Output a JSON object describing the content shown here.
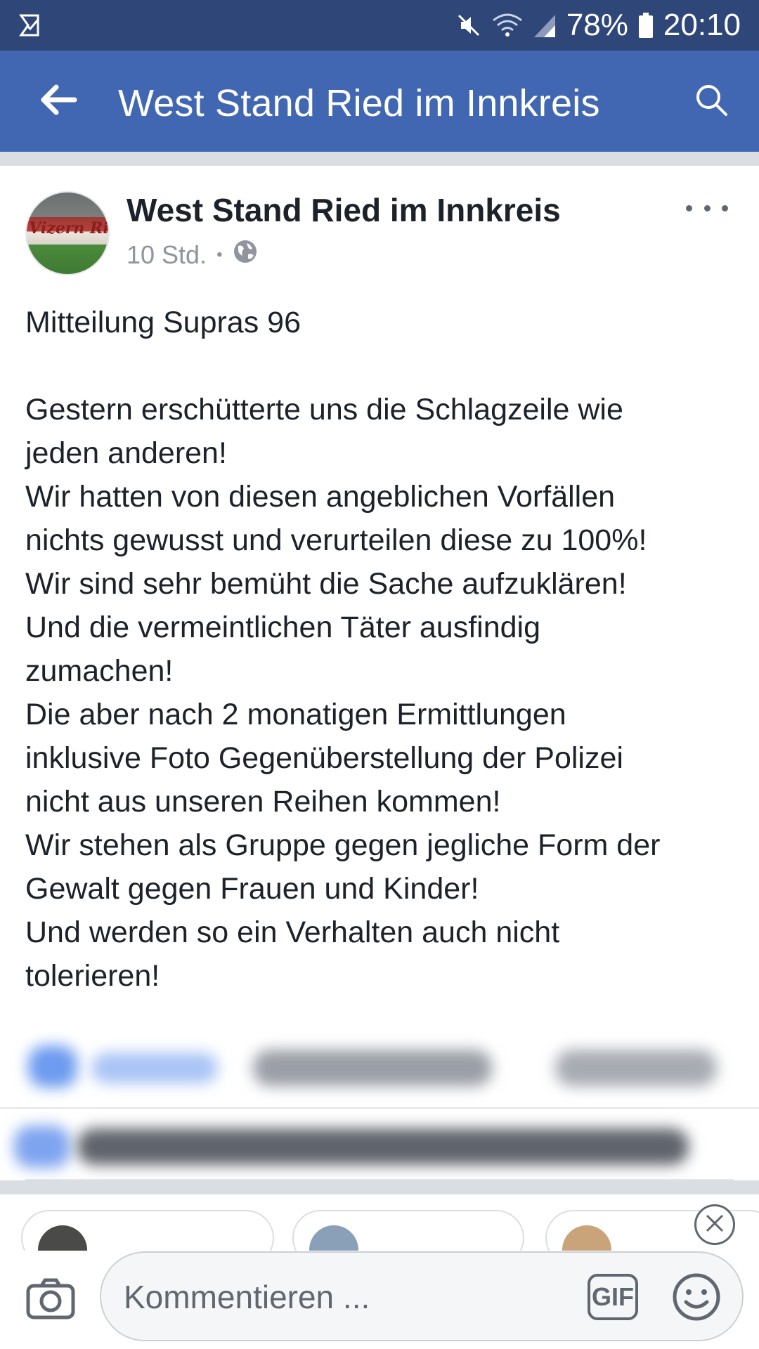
{
  "status_bar": {
    "battery": "78%",
    "time": "20:10",
    "icons": [
      "notification-check-icon",
      "mute-icon",
      "wifi-icon",
      "signal-icon",
      "battery-icon"
    ]
  },
  "app_bar": {
    "title": "West Stand Ried im Innkreis",
    "icons": [
      "back-arrow-icon",
      "search-icon"
    ]
  },
  "post": {
    "author": "West Stand Ried im Innkreis",
    "time": "10 Std.",
    "separator": "•",
    "privacy_icon": "globe-icon",
    "avatar_text": "Vizern Ri",
    "lines": [
      "Mitteilung Supras 96",
      "",
      "Gestern erschütterte uns die Schlagzeile wie",
      "jeden anderen!",
      "Wir hatten von diesen angeblichen Vorfällen",
      "nichts gewusst und verurteilen diese zu 100%!",
      "Wir sind sehr bemüht die Sache aufzuklären!",
      "Und die vermeintlichen Täter ausfindig",
      "zumachen!",
      "Die aber nach 2 monatigen Ermittlungen",
      "inklusive Foto Gegenüberstellung der Polizei",
      "nicht aus unseren Reihen kommen!",
      "Wir stehen als Gruppe gegen jegliche Form der",
      "Gewalt gegen Frauen und Kinder!",
      "Und werden so ein Verhalten auch nicht",
      "tolerieren!"
    ]
  },
  "composer": {
    "placeholder": "Kommentieren ...",
    "gif_label": "GIF"
  },
  "colors": {
    "status_bar": "#2f4778",
    "app_bar": "#4267b2",
    "divider": "#dadde1",
    "meta_text": "#90949c"
  }
}
